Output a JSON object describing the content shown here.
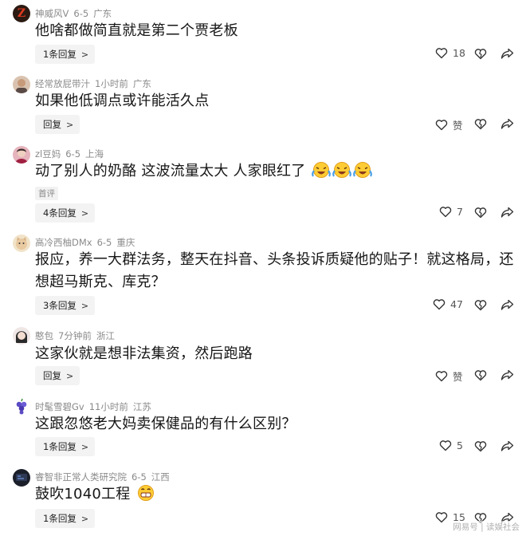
{
  "comments": [
    {
      "user": "神威风V",
      "date": "6-5",
      "region": "广东",
      "text": "他啥都做简直就是第二个贾老板",
      "replies": "1条回复",
      "likes": "18"
    },
    {
      "user": "经常放屁带汁",
      "date": "1小时前",
      "region": "广东",
      "text": "如果他低调点或许能活久点",
      "replies": "回复",
      "likes": "赞"
    },
    {
      "user": "zl豆妈",
      "date": "6-5",
      "region": "上海",
      "text": "动了别人的奶酪 这波流量太大 人家眼红了",
      "tag": "首评",
      "replies": "4条回复",
      "likes": "7"
    },
    {
      "user": "高冷西柚DMx",
      "date": "6-5",
      "region": "重庆",
      "text": "报应，养一大群法务，整天在抖音、头条投诉质疑他的贴子！就这格局，还想超马斯克、库克？",
      "replies": "3条回复",
      "likes": "47"
    },
    {
      "user": "憨包",
      "date": "7分钟前",
      "region": "浙江",
      "text": "这家伙就是想非法集资，然后跑路",
      "replies": "回复",
      "likes": "赞"
    },
    {
      "user": "时髦雪碧Gv",
      "date": "11小时前",
      "region": "江苏",
      "text": "这跟忽悠老大妈卖保健品的有什么区别？",
      "replies": "1条回复",
      "likes": "5"
    },
    {
      "user": "睿智非正常人类研究院",
      "date": "6-5",
      "region": "江西",
      "text": "鼓吹1040工程",
      "replies": "1条回复",
      "likes": "15"
    }
  ],
  "watermark": "网易号 | 读娱社会",
  "icons": {
    "reply_chevron": "chevron-right-icon",
    "like": "heart-icon",
    "dislike": "broken-heart-icon",
    "share": "share-arrow-icon",
    "emoji_laugh": "laughing-crying-emoji-icon",
    "emoji_grin": "grinning-emoji-icon"
  }
}
